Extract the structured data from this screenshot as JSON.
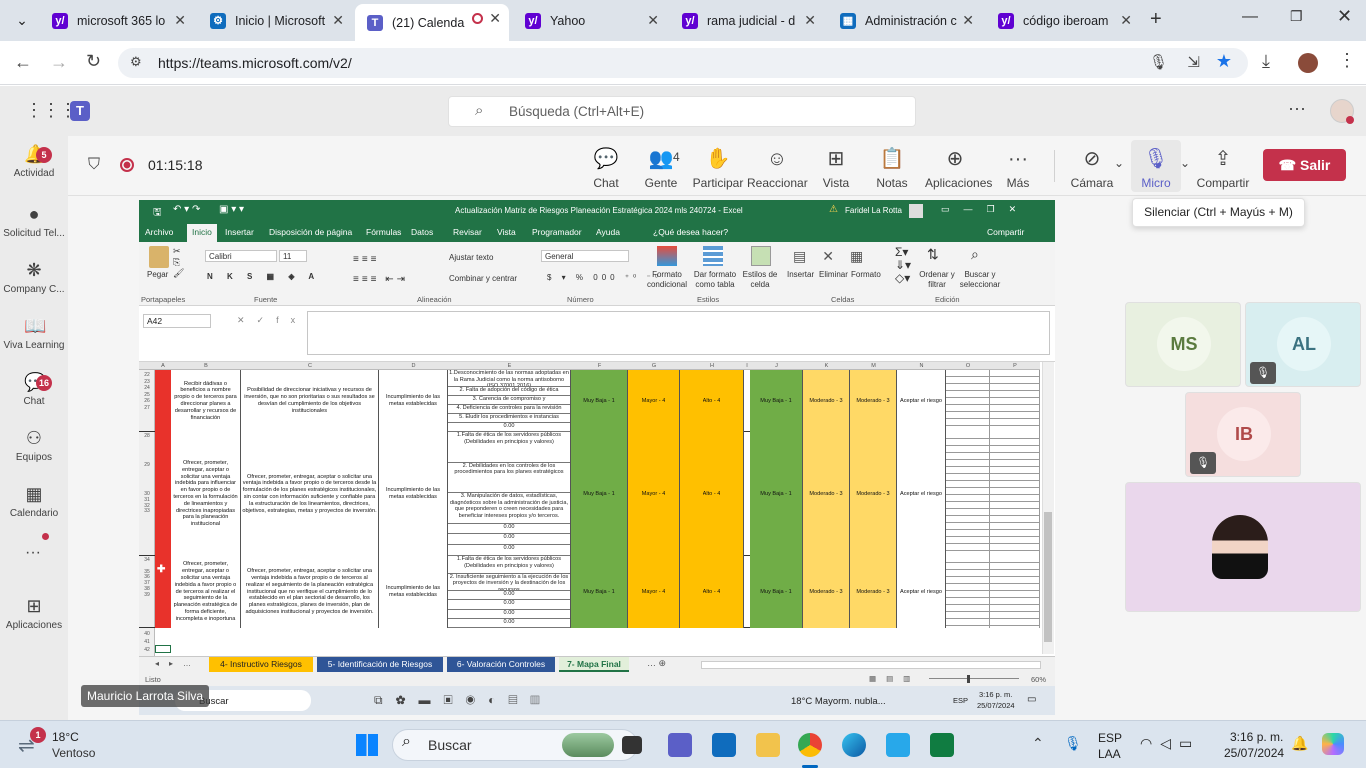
{
  "browser": {
    "tabs": [
      {
        "title": "microsoft 365 lo",
        "color": "#6001d2",
        "glyph": "y/"
      },
      {
        "title": "Inicio | Microsoft",
        "color": "#0f6cbd",
        "glyph": "⚙"
      },
      {
        "title": "(21) Calenda",
        "color": "#5b5fc7",
        "glyph": "T"
      },
      {
        "title": "Yahoo",
        "color": "#6001d2",
        "glyph": "y/"
      },
      {
        "title": "rama judicial - d",
        "color": "#6001d2",
        "glyph": "y/"
      },
      {
        "title": "Administración c",
        "color": "#0f6cbd",
        "glyph": "▦"
      },
      {
        "title": "código iberoam",
        "color": "#6001d2",
        "glyph": "y/"
      }
    ],
    "url": "https://teams.microsoft.com/v2/"
  },
  "teams": {
    "search_placeholder": "Búsqueda (Ctrl+Alt+E)",
    "rail": [
      {
        "label": "Actividad",
        "icon": "bell-icon",
        "badge": "5"
      },
      {
        "label": "Solicitud Tel...",
        "icon": "app-icon",
        "badge": ""
      },
      {
        "label": "Company C...",
        "icon": "company-icon",
        "badge": ""
      },
      {
        "label": "Viva Learning",
        "icon": "book-icon",
        "badge": ""
      },
      {
        "label": "Chat",
        "icon": "chat-icon",
        "badge": "16"
      },
      {
        "label": "Equipos",
        "icon": "teams-icon",
        "badge": ""
      },
      {
        "label": "Calendario",
        "icon": "calendar-icon",
        "badge": ""
      },
      {
        "label": "Aplicaciones",
        "icon": "apps-icon",
        "badge": ""
      }
    ],
    "meeting": {
      "timer": "01:15:18",
      "buttons": [
        "Chat",
        "Gente",
        "Participar",
        "Reaccionar",
        "Vista",
        "Notas",
        "Aplicaciones",
        "Más"
      ],
      "people_count": "4",
      "camera": "Cámara",
      "mic": "Micro",
      "share": "Compartir",
      "leave": "Salir",
      "tooltip": "Silenciar (Ctrl + Mayús + M)",
      "presenter": "Mauricio Larrota Silva"
    },
    "participants": [
      {
        "initials": "MS",
        "bg": "#e8f0e0",
        "fg": "#5b7b3f"
      },
      {
        "initials": "AL",
        "bg": "#d8eef0",
        "fg": "#3b7280"
      },
      {
        "initials": "IB",
        "bg": "#f5dede",
        "fg": "#b04a4a"
      }
    ]
  },
  "excel": {
    "title": "Actualización Matriz de Riesgos Planeación Estratégica 2024 mls 240724  -  Excel",
    "user": "Faridel La Rotta",
    "menu": [
      "Archivo",
      "Inicio",
      "Insertar",
      "Disposición de página",
      "Fórmulas",
      "Datos",
      "Revisar",
      "Vista",
      "Programador",
      "Ayuda",
      "¿Qué desea hacer?",
      "Compartir"
    ],
    "ribbon": {
      "paste": "Pegar",
      "font": "Calibri",
      "size": "11",
      "wrap": "Ajustar texto",
      "merge": "Combinar y centrar",
      "format": "General",
      "cond": "Formato condicional",
      "table": "Dar formato como tabla",
      "styles": "Estilos de celda",
      "insert": "Insertar",
      "delete": "Eliminar",
      "formatc": "Formato",
      "sort": "Ordenar y filtrar",
      "find": "Buscar y seleccionar",
      "groups": [
        "Portapapeles",
        "Fuente",
        "Alineación",
        "Número",
        "Estilos",
        "Celdas",
        "Edición"
      ]
    },
    "namebox": "A42",
    "columns": [
      "A",
      "B",
      "C",
      "D",
      "E",
      "F",
      "G",
      "H",
      "I",
      "J",
      "K",
      "M",
      "N",
      "O",
      "P"
    ],
    "rows": [
      {
        "nums": "22\n23\n24\n25\n26\n27",
        "b": "Recibir dádivas o beneficios a nombre propio o de terceros para direccionar planes a desarrollar y recursos de financiación",
        "c": "Posibilidad de direccionar iniciativas y recursos de inversión, que no son prioritarias o sus resultados se desvían del cumplimiento de los objetivos institucionales",
        "d": "Incumplimiento de las metas establecidas",
        "e": [
          "1.Desconocimiento de las normas adoptadas en la Rama Judicial como la norma antisoborno (ISO 37001 2016)",
          "2. Falta de adopción del código de ética",
          "3. Carencia de compromiso y",
          "4. Deficiencia de controles para la revisión",
          "5. Eludir los procedimientos e instancias",
          "0.00"
        ],
        "f": "Muy Baja - 1",
        "g": "Mayor - 4",
        "h": "Alto - 4",
        "j": "Muy Baja - 1",
        "k": "Moderado - 3",
        "m": "Moderado - 3",
        "n": "Aceptar el riesgo"
      },
      {
        "nums": "28\n\n\n\n\n29\n\n\n\n\n30\n31\n32\n33",
        "b": "Ofrecer, prometer, entregar, aceptar o solicitar una ventaja indebida para influenciar en favor propio o de terceros en la formulación de lineamientos y directrices inapropiadas para la planeación institucional",
        "c": "Ofrecer, prometer, entregar, aceptar o solicitar una ventaja indebida a favor propio o de terceros desde la formulación de los planes estratégicos institucionales, sin contar con información suficiente y confiable para la estructuración de los lineamientos, directrices, objetivos, estrategias, metas y proyectos de inversión.",
        "d": "Incumplimiento de las metas establecidas",
        "e": [
          "1.Falta de ética de los servidores públicos (Debilidades en principios y valores)",
          "2. Debilidades en los controles de los procedimientos para los planes estratégicos",
          "3. Manipulación de datos, estadísticas, diagnósticos sobre la administración de justicia, que preponderen o creen necesidades para beneficiar intereses propios y/o terceros.",
          "0.00",
          "0.00",
          "0.00"
        ],
        "f": "Muy Baja - 1",
        "g": "Mayor - 4",
        "h": "Alto - 4",
        "j": "Muy Baja - 1",
        "k": "Moderado - 3",
        "m": "Moderado - 3",
        "n": "Aceptar el riesgo"
      },
      {
        "nums": "34\n\n35\n36\n37\n38\n39",
        "b": "Ofrecer, prometer, entregar, aceptar o solicitar una ventaja indebida a favor propio o de terceros al realizar el seguimiento de la planeación estratégica de forma deficiente, incompleta e inoportuna",
        "c": "Ofrecer, prometer, entregar, aceptar o solicitar una ventaja indebida a favor propio o de terceros al realizar el seguimiento de la planeación estratégica institucional que no verifique el cumplimiento de lo establecido en el plan sectorial de desarrollo, los planes estratégicos, planes de inversión, plan de adquisiciones institucional y proyectos de inversión.",
        "d": "Incumplimiento de las metas establecidas",
        "e": [
          "1.Falta de ética de los servidores públicos (Debilidades en principios y valores)",
          "2. Insuficiente seguimiento a la ejecución de los proyectos de inversión y la destinación de los recursos",
          "0.00",
          "0.00",
          "0.00",
          "0.00"
        ],
        "f": "Muy Baja - 1",
        "g": "Mayor - 4",
        "h": "Alto - 4",
        "j": "Muy Baja - 1",
        "k": "Moderado - 3",
        "m": "Moderado - 3",
        "n": "Aceptar el riesgo"
      }
    ],
    "tail_rows": "40\n41\n42",
    "sheets": [
      "4- Instructivo Riesgos",
      "5- Identificación de Riesgos",
      "6- Valoración Controles",
      "7- Mapa Final"
    ],
    "sheet_colors": [
      "#ffc000",
      "#2f5597",
      "#2f5597",
      "#e2efda"
    ],
    "status_left": "Listo",
    "zoom": "60%",
    "inner_taskbar": {
      "search": "Buscar",
      "weather": "18°C  Mayorm. nubla...",
      "lang": "ESP",
      "time": "3:16 p. m.",
      "date": "25/07/2024"
    }
  },
  "taskbar": {
    "temp": "18°C",
    "weather": "Ventoso",
    "weather_badge": "1",
    "search": "Buscar",
    "lang1": "ESP",
    "lang2": "LAA",
    "time": "3:16 p. m.",
    "date": "25/07/2024"
  }
}
